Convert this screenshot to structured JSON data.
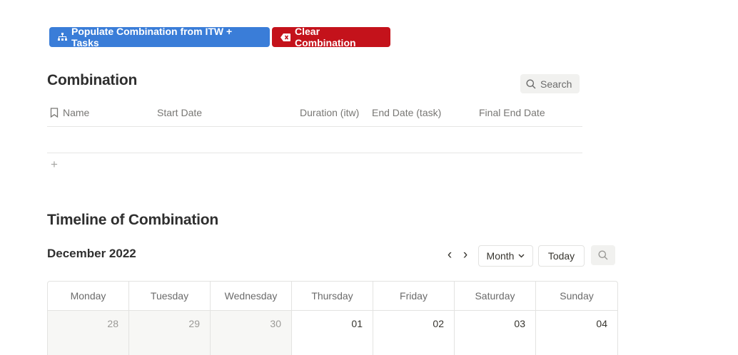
{
  "toolbar": {
    "populate_label": "Populate Combination from ITW + Tasks",
    "clear_label": "Clear Combination"
  },
  "combination": {
    "title": "Combination",
    "search_label": "Search",
    "columns": [
      "Name",
      "Start Date",
      "Duration (itw)",
      "End Date (task)",
      "Final End Date"
    ],
    "add_symbol": "+"
  },
  "timeline": {
    "title": "Timeline of Combination",
    "month_label": "December 2022",
    "prev_symbol": "‹",
    "next_symbol": "›",
    "view_label": "Month",
    "today_label": "Today",
    "weekdays": [
      "Monday",
      "Tuesday",
      "Wednesday",
      "Thursday",
      "Friday",
      "Saturday",
      "Sunday"
    ],
    "days": [
      "28",
      "29",
      "30",
      "01",
      "02",
      "03",
      "04"
    ]
  },
  "colors": {
    "blue_button": "#3a7dd8",
    "red_button": "#c4121b"
  }
}
